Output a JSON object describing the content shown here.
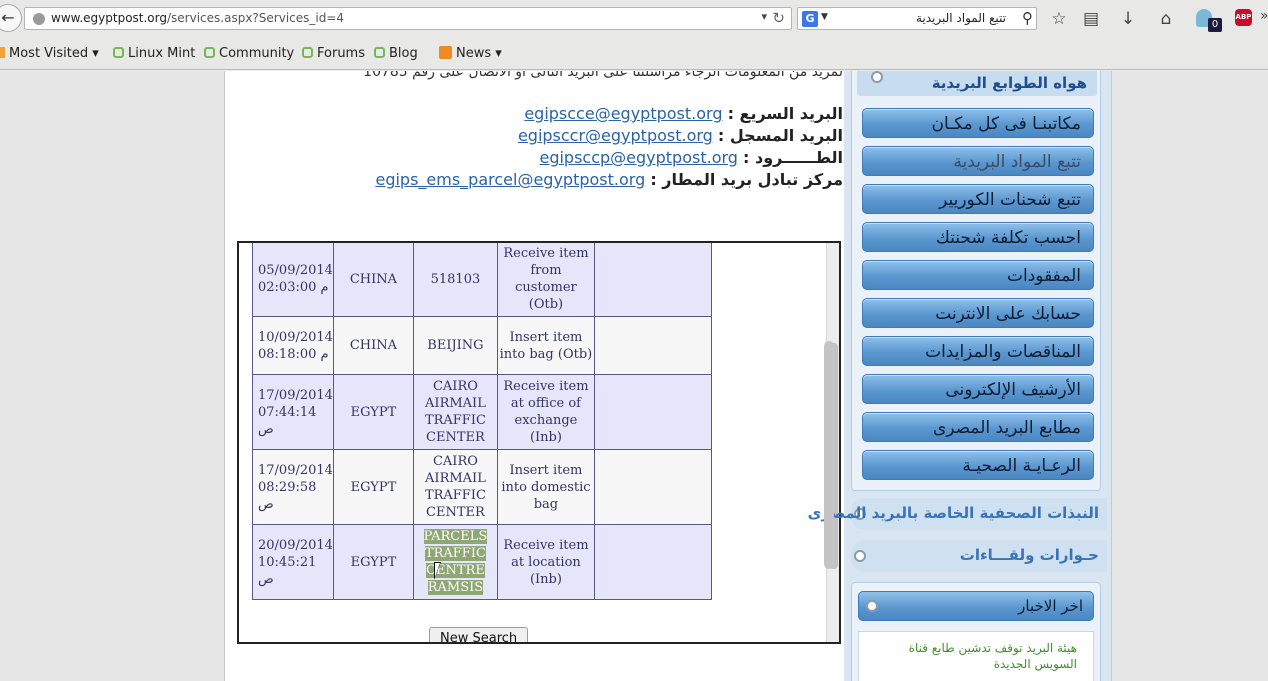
{
  "browser": {
    "url_host": "www.egyptpost.org",
    "url_path": "/services.aspx?Services_id=4",
    "search_engine_icon": "G",
    "search_text": "تتبع المواد البريدية",
    "ghost_count": "0",
    "abp_label": "ABP"
  },
  "bookmarks": [
    {
      "label": "Most Visited",
      "icon": "folder-icon",
      "dropdown": true
    },
    {
      "label": "Linux Mint",
      "icon": "mint-icon"
    },
    {
      "label": "Community",
      "icon": "mint-icon"
    },
    {
      "label": "Forums",
      "icon": "mint-icon"
    },
    {
      "label": "Blog",
      "icon": "mint-icon"
    },
    {
      "label": "News",
      "icon": "rss-icon",
      "dropdown": true
    }
  ],
  "content": {
    "cut_line": "لمزيد من المعلومات الرجاء مراسلتنا على البريد التالى او الاتصال على رقم 10785",
    "contacts": [
      {
        "label": "البريد السريع :",
        "email": "egipscce@egyptpost.org"
      },
      {
        "label": "البريد المسجل :",
        "email": "egipsccr@egyptpost.org"
      },
      {
        "label": "الطــــــرود :",
        "email": "egipsccp@egyptpost.org"
      },
      {
        "label": "مركز تبادل بريد المطار :",
        "email": "egips_ems_parcel@egyptpost.org"
      }
    ],
    "tracking_rows": [
      {
        "date": "05/09/2014",
        "time": "02:03:00 م",
        "country": "CHINA",
        "office": "518103",
        "event": "Receive item from customer (Otb)",
        "extra": ""
      },
      {
        "date": "10/09/2014",
        "time": "08:18:00 م",
        "country": "CHINA",
        "office": "BEIJING",
        "event": "Insert item into bag (Otb)",
        "extra": ""
      },
      {
        "date": "17/09/2014",
        "time": "07:44:14 ص",
        "country": "EGYPT",
        "office": "CAIRO AIRMAIL TRAFFIC CENTER",
        "event": "Receive item at office of exchange (Inb)",
        "extra": ""
      },
      {
        "date": "17/09/2014",
        "time": "08:29:58 ص",
        "country": "EGYPT",
        "office": "CAIRO AIRMAIL TRAFFIC CENTER",
        "event": "Insert item into domestic bag",
        "extra": ""
      },
      {
        "date": "20/09/2014",
        "time": "10:45:21 ص",
        "country": "EGYPT",
        "office": "PARCELS TRAFFIC CENTRE RAMSIS",
        "event": "Receive item at location (Inb)",
        "extra": ""
      }
    ],
    "new_search_label": "New Search"
  },
  "sidebar": {
    "panel_title": "هواه الطوابع البريدية",
    "menu": [
      {
        "label": "مكاتبنـا فى كل مكـان",
        "current": false
      },
      {
        "label": "تتبع المواد البريدية",
        "current": true
      },
      {
        "label": "تتبع شحنات الكوريير",
        "current": false
      },
      {
        "label": "احسب تكلفة شحنتك",
        "current": false
      },
      {
        "label": "المفقودات",
        "current": false
      },
      {
        "label": "حسابك على الانترنت",
        "current": false
      },
      {
        "label": "المناقصات والمزايدات",
        "current": false
      },
      {
        "label": "الأرشيف الإلكترونى",
        "current": false
      },
      {
        "label": "مطابع البريد المصرى",
        "current": false
      },
      {
        "label": "الرعـايـة الصحيـة",
        "current": false
      }
    ],
    "sections": [
      {
        "label": "النبذات الصحفية الخاصة بالبريد المصرى"
      },
      {
        "label": "حـوارات ولقـــاءات"
      }
    ],
    "news_title": "اخر الاخبار",
    "news_item": "هيئة البريد توقف تدشين طابع قناة السويس الجديدة"
  },
  "colors": {
    "table_bg": "#e6e6fa",
    "table_text": "#333366",
    "link": "#2a63a8",
    "sidebar_button": "#5b97cf",
    "selection": "#8fa774"
  }
}
